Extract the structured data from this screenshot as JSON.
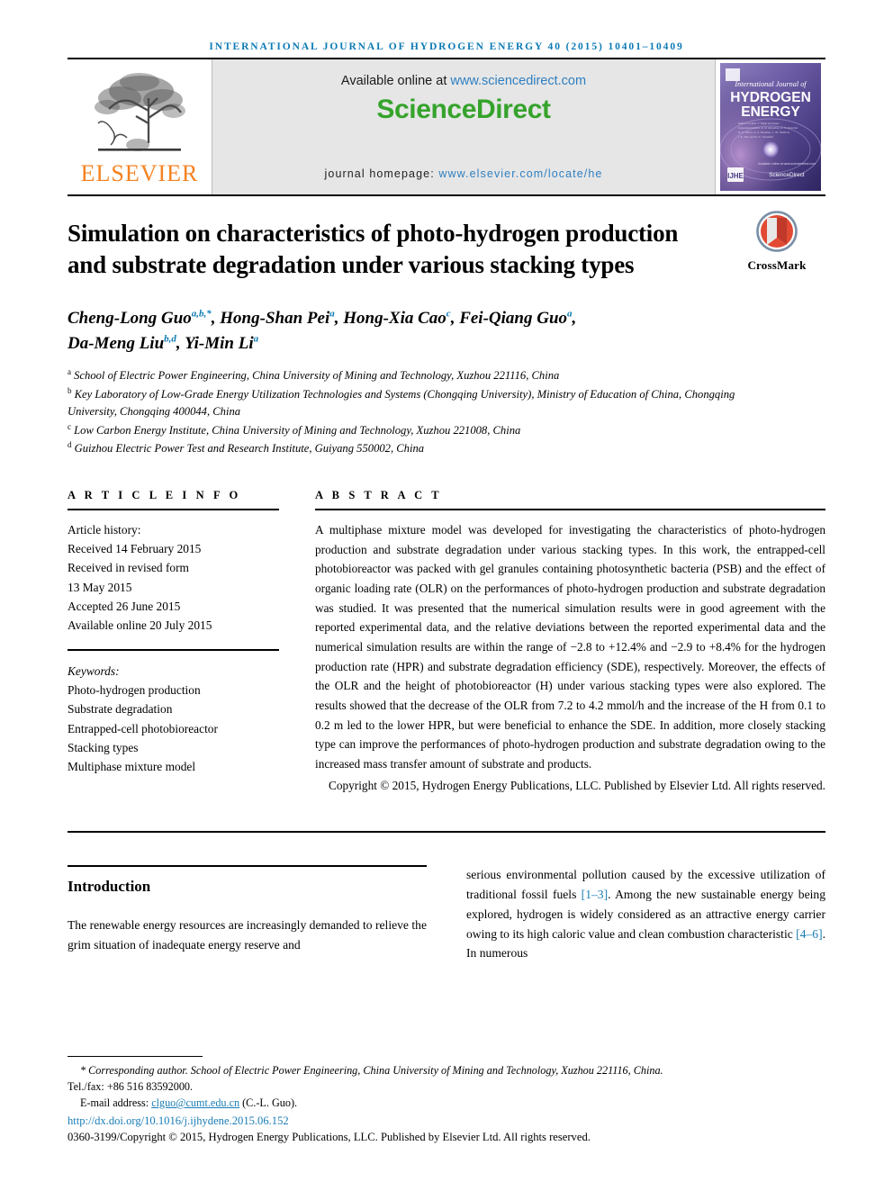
{
  "running_head": "INTERNATIONAL JOURNAL OF HYDROGEN ENERGY 40 (2015) 10401–10409",
  "masthead": {
    "publisher_name": "ELSEVIER",
    "available_prefix": "Available online at ",
    "available_url": "www.sciencedirect.com",
    "brand": "ScienceDirect",
    "homepage_prefix": "journal homepage: ",
    "homepage_url": "www.elsevier.com/locate/he",
    "cover": {
      "line1": "International Journal of",
      "line2": "HYDROGEN",
      "line3": "ENERGY",
      "editor_block": "Editor-in-Chief: T. Nejat Veziroglu\nAssociate Editors: A. M. Elnashar, D. S. Escobar, N. A. Karim, A. C. Rosales, L.W. Steffens, I. E. Tsoi, and F. A. Yamaishi",
      "footer": "Available online at www.sciencedirect.com"
    }
  },
  "article": {
    "title": "Simulation on characteristics of photo-hydrogen production and substrate degradation under various stacking types",
    "crossmark_label": "CrossMark",
    "authors_line1_parts": [
      {
        "name": "Cheng-Long Guo",
        "sup": "a,b,*"
      },
      {
        "name": "Hong-Shan Pei",
        "sup": "a"
      },
      {
        "name": "Hong-Xia Cao",
        "sup": "c"
      },
      {
        "name": "Fei-Qiang Guo",
        "sup": "a"
      }
    ],
    "authors_line2_parts": [
      {
        "name": "Da-Meng Liu",
        "sup": "b,d"
      },
      {
        "name": "Yi-Min Li",
        "sup": "a"
      }
    ],
    "affiliations": [
      {
        "mark": "a",
        "text": "School of Electric Power Engineering, China University of Mining and Technology, Xuzhou 221116, China"
      },
      {
        "mark": "b",
        "text": "Key Laboratory of Low-Grade Energy Utilization Technologies and Systems (Chongqing University), Ministry of Education of China, Chongqing University, Chongqing 400044, China"
      },
      {
        "mark": "c",
        "text": "Low Carbon Energy Institute, China University of Mining and Technology, Xuzhou 221008, China"
      },
      {
        "mark": "d",
        "text": "Guizhou Electric Power Test and Research Institute, Guiyang 550002, China"
      }
    ]
  },
  "article_info": {
    "heading": "A R T I C L E   I N F O",
    "history_title": "Article history:",
    "history": [
      "Received 14 February 2015",
      "Received in revised form",
      "13 May 2015",
      "Accepted 26 June 2015",
      "Available online 20 July 2015"
    ],
    "keywords_title": "Keywords:",
    "keywords": [
      "Photo-hydrogen production",
      "Substrate degradation",
      "Entrapped-cell photobioreactor",
      "Stacking types",
      "Multiphase mixture model"
    ]
  },
  "abstract": {
    "heading": "A B S T R A C T",
    "text": "A multiphase mixture model was developed for investigating the characteristics of photo-hydrogen production and substrate degradation under various stacking types. In this work, the entrapped-cell photobioreactor was packed with gel granules containing photosynthetic bacteria (PSB) and the effect of organic loading rate (OLR) on the performances of photo-hydrogen production and substrate degradation was studied. It was presented that the numerical simulation results were in good agreement with the reported experimental data, and the relative deviations between the reported experimental data and the numerical simulation results are within the range of −2.8 to +12.4% and −2.9 to +8.4% for the hydrogen production rate (HPR) and substrate degradation efficiency (SDE), respectively. Moreover, the effects of the OLR and the height of photobioreactor (H) under various stacking types were also explored. The results showed that the decrease of the OLR from 7.2 to 4.2 mmol/h and the increase of the H from 0.1 to 0.2 m led to the lower HPR, but were beneficial to enhance the SDE. In addition, more closely stacking type can improve the performances of photo-hydrogen production and substrate degradation owing to the increased mass transfer amount of substrate and products.",
    "copyright": "Copyright © 2015, Hydrogen Energy Publications, LLC. Published by Elsevier Ltd. All rights reserved."
  },
  "body": {
    "section_title": "Introduction",
    "left_text": "The renewable energy resources are increasingly demanded to relieve the grim situation of inadequate energy reserve and",
    "right_text_1": "serious environmental pollution caused by the excessive utilization of traditional fossil fuels ",
    "right_ref_1": "[1–3]",
    "right_text_2": ". Among the new sustainable energy being explored, hydrogen is widely considered as an attractive energy carrier owing to its high caloric value and clean combustion characteristic ",
    "right_ref_2": "[4–6]",
    "right_text_3": ". In numerous"
  },
  "footnote": {
    "corresponding": "Corresponding author. School of Electric Power Engineering, China University of Mining and Technology, Xuzhou 221116, China.",
    "tel": "Tel./fax: +86 516 83592000.",
    "email_label": "E-mail address: ",
    "email": "clguo@cumt.edu.cn",
    "email_suffix": " (C.-L. Guo).",
    "doi": "http://dx.doi.org/10.1016/j.ijhydene.2015.06.152",
    "issn": "0360-3199/Copyright © 2015, Hydrogen Energy Publications, LLC. Published by Elsevier Ltd. All rights reserved."
  },
  "colors": {
    "journal_blue": "#0b7ab5",
    "link_blue": "#2f7fc1",
    "sciencedirect_green": "#35a32b",
    "elsevier_orange": "#f58220",
    "crossmark_red": "#b5221f"
  }
}
